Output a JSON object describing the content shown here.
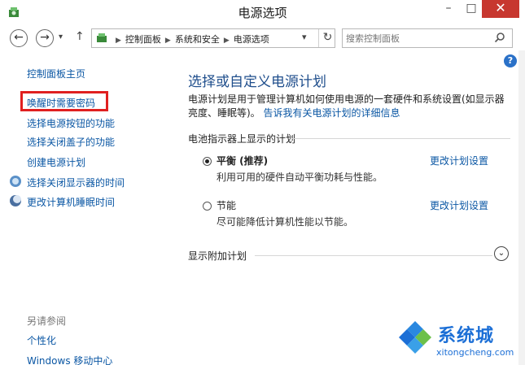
{
  "window": {
    "title": "电源选项",
    "minimize": "–",
    "maximize": "□",
    "close": "✕"
  },
  "addressbar": {
    "back": "←",
    "forward": "→",
    "recent": "▾",
    "up": "↑",
    "breadcrumbs": [
      "控制面板",
      "系统和安全",
      "电源选项"
    ],
    "dropdown": "▾",
    "refresh": "↻",
    "search_placeholder": "搜索控制面板"
  },
  "sidebar": {
    "home": "控制面板主页",
    "items": [
      {
        "label": "唤醒时需要密码",
        "icon": ""
      },
      {
        "label": "选择电源按钮的功能",
        "icon": ""
      },
      {
        "label": "选择关闭盖子的功能",
        "icon": ""
      },
      {
        "label": "创建电源计划",
        "icon": ""
      },
      {
        "label": "选择关闭显示器的时间",
        "icon": "display-icon"
      },
      {
        "label": "更改计算机睡眠时间",
        "icon": "moon-icon"
      }
    ],
    "see_also": "另请参阅",
    "see_also_items": [
      "个性化",
      "Windows 移动中心"
    ]
  },
  "main": {
    "help": "?",
    "heading": "选择或自定义电源计划",
    "intro_text": "电源计划是用于管理计算机如何使用电源的一套硬件和系统设置(如显示器亮度、睡眠等)。",
    "intro_link": "告诉我有关电源计划的详细信息",
    "group_label": "电池指示器上显示的计划",
    "plans": [
      {
        "name": "平衡 (推荐)",
        "desc": "利用可用的硬件自动平衡功耗与性能。",
        "link": "更改计划设置",
        "selected": true
      },
      {
        "name": "节能",
        "desc": "尽可能降低计算机性能以节能。",
        "link": "更改计划设置",
        "selected": false
      }
    ],
    "extra_label": "显示附加计划",
    "expand": "⌄"
  },
  "watermark": {
    "brand": "系统城",
    "url": "xitongcheng.com"
  },
  "colors": {
    "link": "#0b57a4",
    "heading": "#1f4e8c",
    "close": "#c7372f",
    "highlight": "#e02020",
    "watermark": "#1c6fd6"
  }
}
